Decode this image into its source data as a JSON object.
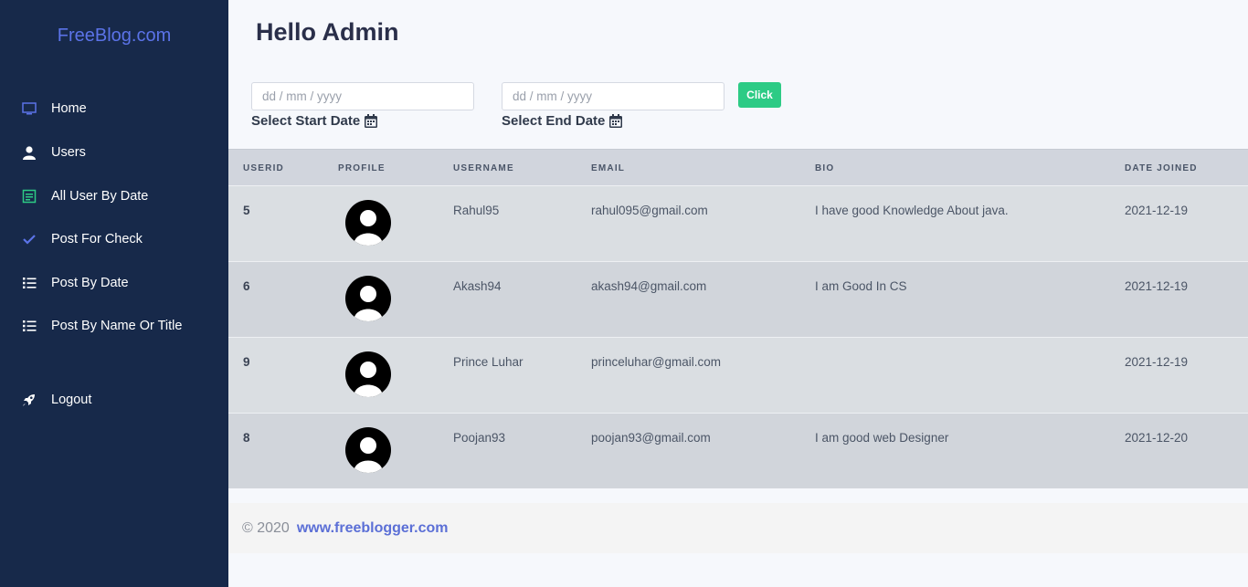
{
  "brand": "FreeBlog.com",
  "nav": [
    {
      "label": "Home",
      "icon": "monitor-icon"
    },
    {
      "label": "Users",
      "icon": "user-icon"
    },
    {
      "label": "All User By Date",
      "icon": "calendar-card-icon"
    },
    {
      "label": "Post For Check",
      "icon": "check-icon"
    },
    {
      "label": "Post By Date",
      "icon": "list-icon"
    },
    {
      "label": "Post By Name Or Title",
      "icon": "list-icon"
    },
    {
      "label": "Logout",
      "icon": "rocket-icon"
    }
  ],
  "header": {
    "title": "Hello Admin"
  },
  "filters": {
    "start_placeholder": "dd / mm / yyyy",
    "end_placeholder": "dd / mm / yyyy",
    "start_label": "Select Start Date",
    "end_label": "Select End Date",
    "button_label": "Click"
  },
  "table": {
    "headers": [
      "USERID",
      "PROFILE",
      "USERNAME",
      "EMAIL",
      "BIO",
      "DATE JOINED"
    ],
    "rows": [
      {
        "userid": "5",
        "username": "Rahul95",
        "email": "rahul095@gmail.com",
        "bio": "I have good Knowledge About java.",
        "date": "2021-12-19"
      },
      {
        "userid": "6",
        "username": "Akash94",
        "email": "akash94@gmail.com",
        "bio": "I am Good In CS",
        "date": "2021-12-19"
      },
      {
        "userid": "9",
        "username": "Prince Luhar",
        "email": "princeluhar@gmail.com",
        "bio": "",
        "date": "2021-12-19"
      },
      {
        "userid": "8",
        "username": "Poojan93",
        "email": "poojan93@gmail.com",
        "bio": "I am good web Designer",
        "date": "2021-12-20"
      }
    ]
  },
  "footer": {
    "copyright": "© 2020",
    "link": "www.freeblogger.com"
  },
  "colors": {
    "sidebar": "#17294a",
    "brand": "#5b73e8",
    "button": "#2dcb85"
  }
}
